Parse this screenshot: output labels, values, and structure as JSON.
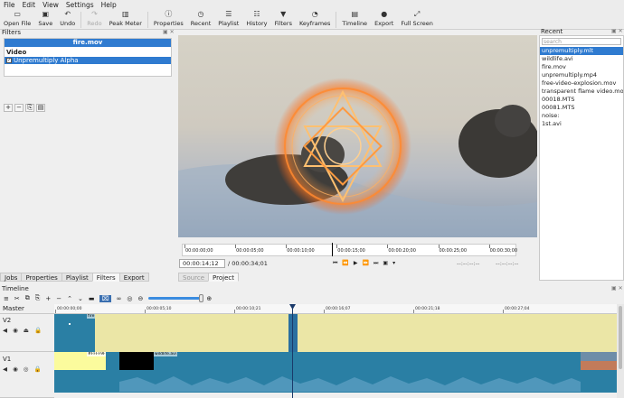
{
  "menu": [
    "File",
    "Edit",
    "View",
    "Settings",
    "Help"
  ],
  "toolbar": [
    {
      "label": "Open File",
      "icon": "folder-icon",
      "glyph": "▭",
      "disabled": false
    },
    {
      "label": "Save",
      "icon": "save-icon",
      "glyph": "▣",
      "disabled": false
    },
    {
      "label": "Undo",
      "icon": "undo-icon",
      "glyph": "↶",
      "disabled": false
    },
    {
      "label": "Redo",
      "icon": "redo-icon",
      "glyph": "↷",
      "disabled": true
    },
    {
      "label": "Peak Meter",
      "icon": "peak-meter-icon",
      "glyph": "▥",
      "disabled": false
    },
    {
      "label": "Properties",
      "icon": "info-icon",
      "glyph": "ⓘ",
      "disabled": false
    },
    {
      "label": "Recent",
      "icon": "clock-icon",
      "glyph": "◷",
      "disabled": false
    },
    {
      "label": "Playlist",
      "icon": "playlist-icon",
      "glyph": "☰",
      "disabled": false
    },
    {
      "label": "History",
      "icon": "history-icon",
      "glyph": "☷",
      "disabled": false
    },
    {
      "label": "Filters",
      "icon": "funnel-icon",
      "glyph": "▼",
      "disabled": false
    },
    {
      "label": "Keyframes",
      "icon": "keyframes-icon",
      "glyph": "◔",
      "disabled": false
    },
    {
      "label": "Timeline",
      "icon": "timeline-icon",
      "glyph": "▤",
      "disabled": false
    },
    {
      "label": "Export",
      "icon": "export-icon",
      "glyph": "●",
      "disabled": false
    },
    {
      "label": "Full Screen",
      "icon": "fullscreen-icon",
      "glyph": "⤢",
      "disabled": false
    }
  ],
  "filters": {
    "title": "Filters",
    "clip_name": "fire.mov",
    "section": "Video",
    "items": [
      {
        "label": "Unpremultiply Alpha",
        "checked": true
      }
    ]
  },
  "left_tabs": [
    "Jobs",
    "Properties",
    "Playlist",
    "Filters",
    "Export"
  ],
  "left_tab_active": 3,
  "player": {
    "ruler_labels": [
      "00:00:00;00",
      "00:00:05;00",
      "00:00:10;00",
      "00:00:15;00",
      "00:00:20;00",
      "00:00:25;00",
      "00:00:30;00"
    ],
    "playhead_fraction": 0.445,
    "timecode": "00:00:14;12",
    "duration": "/ 00:00:34;01",
    "in_point": "--:--:--:--",
    "out_point": "--:--:--:--",
    "transport": [
      "⏮",
      "⏪",
      "▶",
      "⏩",
      "⏭",
      "▣",
      "▾"
    ],
    "tabs": [
      "Source",
      "Project"
    ],
    "active_tab": 1
  },
  "recent": {
    "title": "Recent",
    "search_placeholder": "search",
    "items": [
      "unpremultiply.mlt",
      "wildlife.avi",
      "fire.mov",
      "unpremultiply.mp4",
      "free-video-explosion.mov",
      "transparent flame video.mov",
      "00018.MTS",
      "00081.MTS",
      "noise:",
      "1st.avi"
    ],
    "selected": 0
  },
  "timeline": {
    "title": "Timeline",
    "tools": [
      "≡",
      "✂",
      "⧉",
      "⎘",
      "+",
      "−",
      "⌃",
      "⌄",
      "▬",
      "⌧",
      "∞",
      "◎",
      "⊖"
    ],
    "ruler_labels": [
      "00:00:00;00",
      "00:00:05;10",
      "00:00:10;21",
      "00:00:16;07",
      "00:00:21;18",
      "00:00:27;04"
    ],
    "tracks": [
      {
        "name": "Master"
      },
      {
        "name": "V2",
        "icons": "◀ ◉ ⏏ 🔒"
      },
      {
        "name": "V1",
        "icons": "◀ ◉ ◎ 🔒"
      }
    ],
    "clips": {
      "v2_first_label": "fire",
      "v1_yellow_label": "#FFFF9F",
      "v1_black_label": "wildlife.avi"
    }
  },
  "colors": {
    "accent": "#2f7bd0",
    "v2_track": "#ebe6a6",
    "clip_blue": "#2a7fa4",
    "clip_yellow": "#fbfb9d",
    "playhead": "#1a3a6a"
  }
}
